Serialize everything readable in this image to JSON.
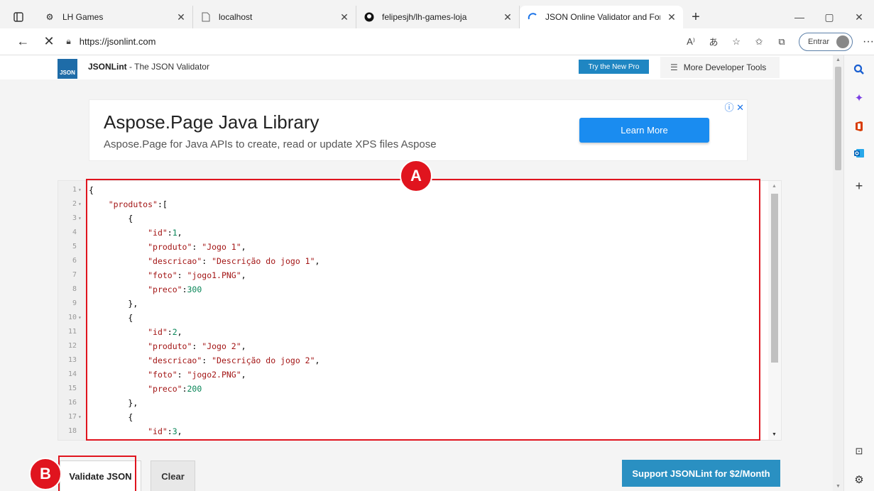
{
  "tabs": [
    {
      "label": "LH Games",
      "icon": "gear-icon",
      "active": false
    },
    {
      "label": "localhost",
      "icon": "page-icon",
      "active": false
    },
    {
      "label": "felipesjh/lh-games-loja",
      "icon": "github-icon",
      "active": false
    },
    {
      "label": "JSON Online Validator and Form",
      "icon": "loading-icon",
      "active": true
    }
  ],
  "address": {
    "url": "https://jsonlint.com",
    "signin_label": "Entrar"
  },
  "site": {
    "logo_text": "JSON",
    "brand_name": "JSONLint",
    "brand_tagline": "- The JSON Validator",
    "pro_button": "Try the New Pro",
    "more_tools": "More Developer Tools"
  },
  "ad": {
    "title": "Aspose.Page Java Library",
    "subtitle": "Aspose.Page for Java APIs to create, read or update XPS files Aspose",
    "button": "Learn More"
  },
  "editor": {
    "lines": [
      {
        "n": "1",
        "fold": "▾",
        "html": "<span class=\"p\">{</span>"
      },
      {
        "n": "2",
        "fold": "▾",
        "html": "    <span class=\"k\">\"produtos\"</span><span class=\"p\">:[</span>"
      },
      {
        "n": "3",
        "fold": "▾",
        "html": "        <span class=\"p\">{</span>"
      },
      {
        "n": "4",
        "fold": "",
        "html": "            <span class=\"k\">\"id\"</span><span class=\"p\">:</span><span class=\"n\">1</span><span class=\"p\">,</span>"
      },
      {
        "n": "5",
        "fold": "",
        "html": "            <span class=\"k\">\"produto\"</span><span class=\"p\">: </span><span class=\"s\">\"Jogo 1\"</span><span class=\"p\">,</span>"
      },
      {
        "n": "6",
        "fold": "",
        "html": "            <span class=\"k\">\"descricao\"</span><span class=\"p\">: </span><span class=\"s\">\"Descrição do jogo 1\"</span><span class=\"p\">,</span>"
      },
      {
        "n": "7",
        "fold": "",
        "html": "            <span class=\"k\">\"foto\"</span><span class=\"p\">: </span><span class=\"s\">\"jogo1.PNG\"</span><span class=\"p\">,</span>"
      },
      {
        "n": "8",
        "fold": "",
        "html": "            <span class=\"k\">\"preco\"</span><span class=\"p\">:</span><span class=\"n\">300</span>"
      },
      {
        "n": "9",
        "fold": "",
        "html": "        <span class=\"p\">},</span>"
      },
      {
        "n": "10",
        "fold": "▾",
        "html": "        <span class=\"p\">{</span>"
      },
      {
        "n": "11",
        "fold": "",
        "html": "            <span class=\"k\">\"id\"</span><span class=\"p\">:</span><span class=\"n\">2</span><span class=\"p\">,</span>"
      },
      {
        "n": "12",
        "fold": "",
        "html": "            <span class=\"k\">\"produto\"</span><span class=\"p\">: </span><span class=\"s\">\"Jogo 2\"</span><span class=\"p\">,</span>"
      },
      {
        "n": "13",
        "fold": "",
        "html": "            <span class=\"k\">\"descricao\"</span><span class=\"p\">: </span><span class=\"s\">\"Descrição do jogo 2\"</span><span class=\"p\">,</span>"
      },
      {
        "n": "14",
        "fold": "",
        "html": "            <span class=\"k\">\"foto\"</span><span class=\"p\">: </span><span class=\"s\">\"jogo2.PNG\"</span><span class=\"p\">,</span>"
      },
      {
        "n": "15",
        "fold": "",
        "html": "            <span class=\"k\">\"preco\"</span><span class=\"p\">:</span><span class=\"n\">200</span>"
      },
      {
        "n": "16",
        "fold": "",
        "html": "        <span class=\"p\">},</span>"
      },
      {
        "n": "17",
        "fold": "▾",
        "html": "        <span class=\"p\">{</span>"
      },
      {
        "n": "18",
        "fold": "",
        "html": "            <span class=\"k\">\"id\"</span><span class=\"p\">:</span><span class=\"n\">3</span><span class=\"p\">,</span>"
      }
    ]
  },
  "buttons": {
    "validate": "Validate JSON",
    "clear": "Clear",
    "support": "Support JSONLint for $2/Month"
  },
  "annotations": {
    "a": "A",
    "b": "B",
    "color": "#e0141e"
  }
}
